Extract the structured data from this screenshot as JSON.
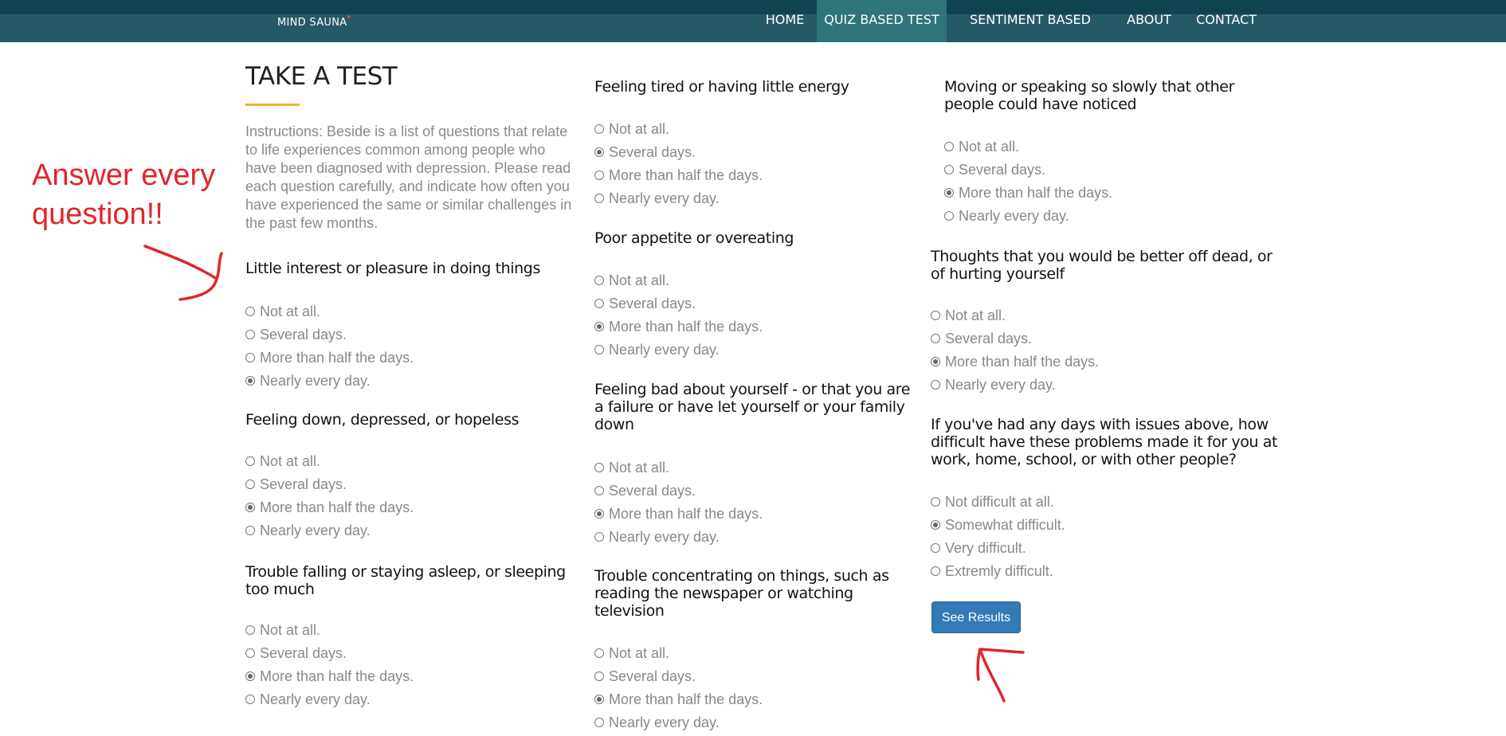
{
  "navbar": {
    "brand": "MIND SAUNA",
    "items": [
      {
        "label": "HOME",
        "active": false
      },
      {
        "label": "QUIZ BASED TEST",
        "active": true
      },
      {
        "label": "SENTIMENT BASED TEST",
        "active": false
      },
      {
        "label": "ABOUT",
        "active": false
      },
      {
        "label": "CONTACT",
        "active": false
      }
    ]
  },
  "page": {
    "title": "TAKE A TEST",
    "instructions": "Instructions: Beside is a list of questions that relate to life experiences common among people who have been diagnosed with depression. Please read each question carefully, and indicate how often you have experienced the same or similar challenges in the past few months."
  },
  "frequency_options": [
    "Not at all.",
    "Several days.",
    "More than half the days.",
    "Nearly every day."
  ],
  "difficulty_options": [
    "Not difficult at all.",
    "Somewhat difficult.",
    "Very difficult.",
    "Extremly difficult."
  ],
  "questions": [
    {
      "text": "Little interest or pleasure in doing things",
      "selected": 3
    },
    {
      "text": "Feeling down, depressed, or hopeless",
      "selected": 2
    },
    {
      "text": "Trouble falling or staying asleep, or sleeping too much",
      "selected": 2
    },
    {
      "text": "Feeling tired or having little energy",
      "selected": 1
    },
    {
      "text": "Poor appetite or overeating",
      "selected": 2
    },
    {
      "text": "Feeling bad about yourself - or that you are a failure or have let yourself or your family down",
      "selected": 2
    },
    {
      "text": "Trouble concentrating on things, such as reading the newspaper or watching television",
      "selected": 2
    },
    {
      "text": "Moving or speaking so slowly that other people could have noticed",
      "selected": 2
    },
    {
      "text": "Thoughts that you would be better off dead, or of hurting yourself",
      "selected": 2
    },
    {
      "text": "If you've had any days with issues above, how difficult have these problems made it for you at work, home, school, or with other people?",
      "selected": 1
    }
  ],
  "submit_label": "See Results",
  "annotation": {
    "text_line1": "Answer every",
    "text_line2": "question!!",
    "color": "#e0262c"
  }
}
